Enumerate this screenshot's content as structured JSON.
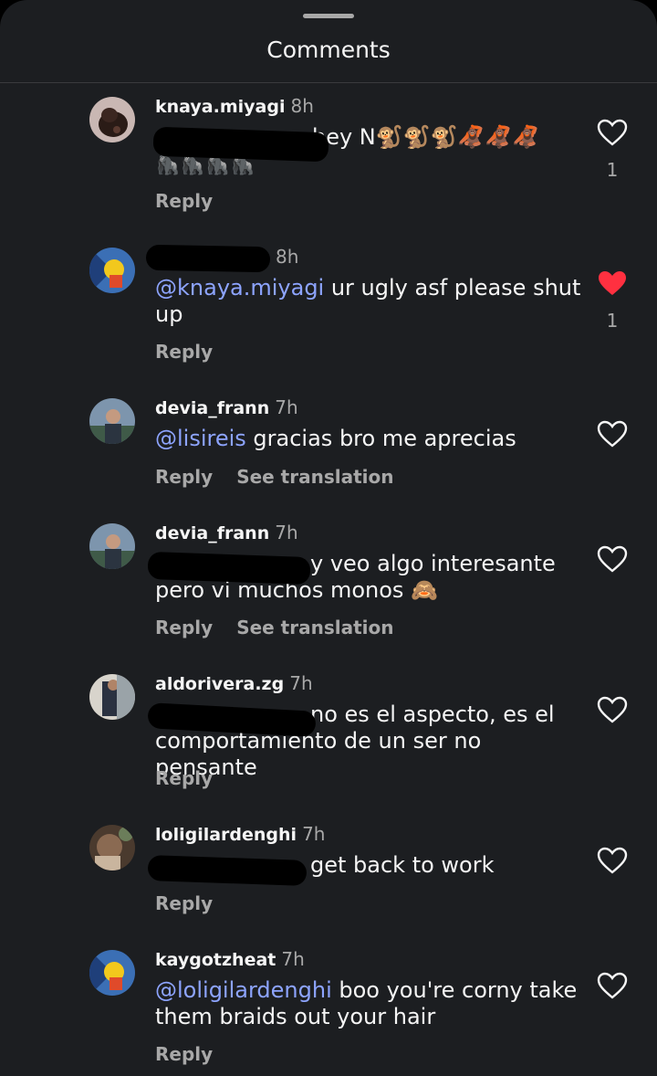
{
  "header": {
    "title": "Comments"
  },
  "comments": [
    {
      "username": "knaya.miyagi",
      "time": "8h",
      "text_after": "hey N🐒🐒🐒🦧🦧🦧",
      "text_line2": "🦍🦍🦍🦍",
      "likes": "1",
      "liked": false,
      "reply": "Reply"
    },
    {
      "username": "",
      "time": "8h",
      "mention": "@knaya.miyagi",
      "text": " ur ugly asf please shut up",
      "likes": "1",
      "liked": true,
      "reply": "Reply"
    },
    {
      "username": "devia_frann",
      "time": "7h",
      "mention": "@lisireis",
      "text": " gracias bro me aprecias",
      "liked": false,
      "reply": "Reply",
      "translate": "See translation"
    },
    {
      "username": "devia_frann",
      "time": "7h",
      "text_after": "y veo algo interesante",
      "text_line2": "pero vi muchos monos 🙈",
      "liked": false,
      "reply": "Reply",
      "translate": "See translation"
    },
    {
      "username": "aldorivera.zg",
      "time": "7h",
      "text_after": "no es el aspecto, es el",
      "text_line2": "comportamiento de un ser no pensante",
      "liked": false,
      "reply": "Reply"
    },
    {
      "username": "loligilardenghi",
      "time": "7h",
      "text_after": "get back to work",
      "liked": false,
      "reply": "Reply"
    },
    {
      "username": "kaygotzheat",
      "time": "7h",
      "mention": "@loligilardenghi",
      "text": " boo you're corny take them braids out your hair",
      "liked": false,
      "reply": "Reply"
    }
  ],
  "colors": {
    "background": "#1c1e21",
    "mention": "#8da4ff",
    "liked_heart": "#ff3040",
    "muted": "#a8a8a8"
  }
}
